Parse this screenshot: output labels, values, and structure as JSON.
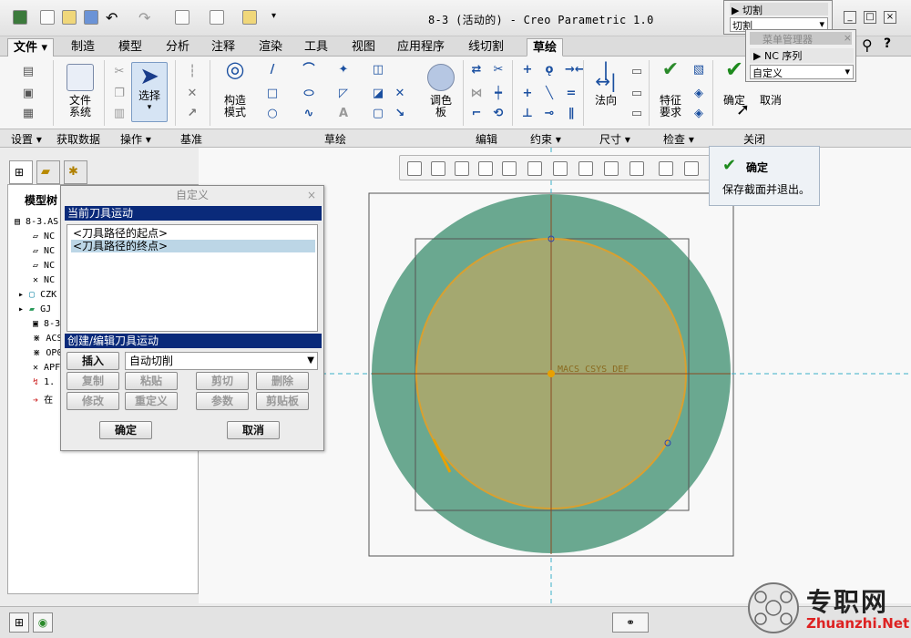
{
  "window": {
    "title": "8-3 (活动的) - Creo Parametric 1.0"
  },
  "menu_tabs": [
    "文件",
    "制造",
    "模型",
    "分析",
    "注释",
    "渲染",
    "工具",
    "视图",
    "应用程序",
    "线切割",
    "草绘"
  ],
  "ribbon": {
    "file_system": "文件\n系统",
    "select": "选择",
    "construction_mode": "构造\n模式",
    "palette": "调色\n板",
    "normal": "法向",
    "feature_requirements": "特征\n要求",
    "ok": "确定",
    "cancel": "取消"
  },
  "groups": [
    "设置",
    "获取数据",
    "操作",
    "基准",
    "草绘",
    "编辑",
    "约束",
    "尺寸",
    "检查",
    "关闭"
  ],
  "model_tree": {
    "title": "模型树",
    "items": [
      "8-3.AS",
      "NC",
      "NC",
      "NC",
      "NC",
      "CZK",
      "GJ",
      "8-3",
      "ACS",
      "OP0",
      "APF",
      "1.",
      "在"
    ]
  },
  "dialog": {
    "title": "自定义",
    "current_motion_header": "当前刀具运动",
    "motions": [
      "<刀具路径的起点>",
      "<刀具路径的终点>"
    ],
    "create_edit_header": "创建/编辑刀具运动",
    "insert": "插入",
    "mode_value": "自动切削",
    "copy": "复制",
    "paste": "粘贴",
    "cut": "剪切",
    "delete": "删除",
    "modify": "修改",
    "redefine": "重定义",
    "params": "参数",
    "clipboard": "剪贴板",
    "ok": "确定",
    "cancel": "取消"
  },
  "tooltip": {
    "title": "确定",
    "desc": "保存截面并退出。"
  },
  "menu_manager": {
    "cut_header": "切割",
    "cut_value": "切割",
    "title": "菜单管理器",
    "nc_sequence": "NC 序列",
    "customize": "自定义"
  },
  "canvas": {
    "csys_label": "MACS CSYS DEF"
  },
  "watermark": {
    "text": "专职网",
    "url": "Zhuanzhi.Net"
  },
  "colors": {
    "outer_circle": "#6aa890",
    "inner_circle": "#a4a870",
    "sketch": "#e0a000",
    "dialog_header": "#0a2a7a"
  }
}
